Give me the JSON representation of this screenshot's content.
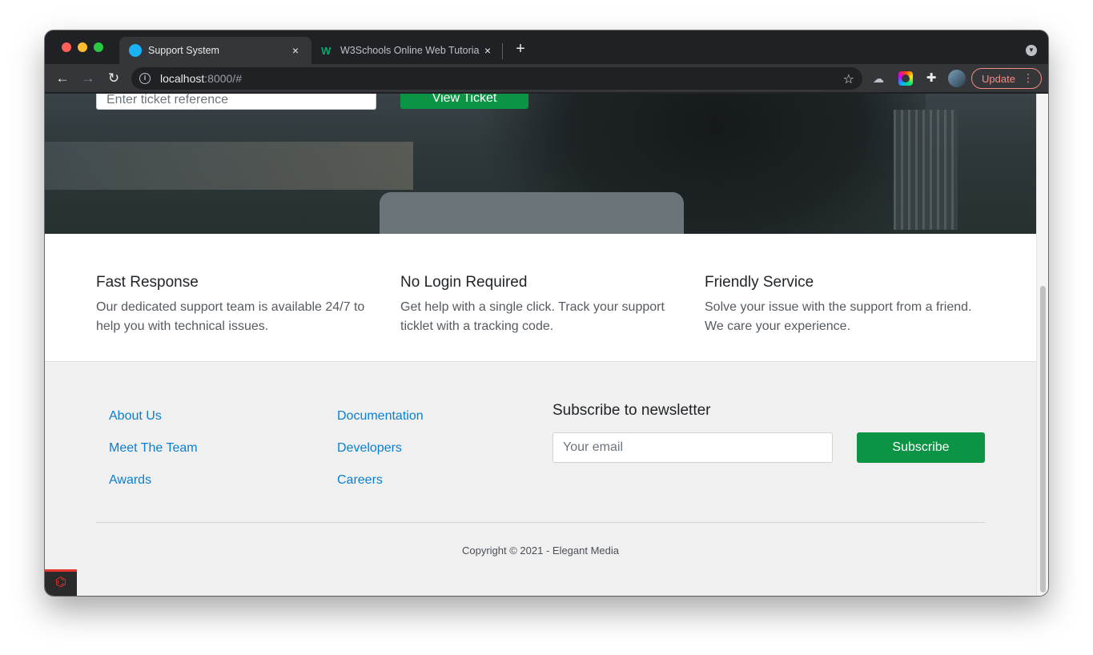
{
  "browser": {
    "tabs": [
      {
        "title": "Support System",
        "active": true
      },
      {
        "title": "W3Schools Online Web Tutoria",
        "active": false
      }
    ],
    "tab_close_glyph": "×",
    "new_tab_glyph": "+",
    "url_host": "localhost",
    "url_rest": ":8000/#",
    "update_label": "Update",
    "accent_colors": {
      "update": "#f28b82",
      "favicon": "#1ab2f5"
    }
  },
  "hero": {
    "ticket_placeholder": "Enter ticket reference",
    "view_ticket_label": "View Ticket"
  },
  "features": [
    {
      "title": "Fast Response",
      "text": "Our dedicated support team is available 24/7 to help you with technical issues."
    },
    {
      "title": "No Login Required",
      "text": "Get help with a single click. Track your support ticklet with a tracking code."
    },
    {
      "title": "Friendly Service",
      "text": "Solve your issue with the support from a friend. We care your experience."
    }
  ],
  "footer": {
    "links_col1": [
      "About Us",
      "Meet The Team",
      "Awards"
    ],
    "links_col2": [
      "Documentation",
      "Developers",
      "Careers"
    ],
    "newsletter_title": "Subscribe to newsletter",
    "email_placeholder": "Your email",
    "subscribe_label": "Subscribe",
    "copyright": "Copyright © 2021 - Elegant Media",
    "colors": {
      "link": "#0a7fd1",
      "button": "#0b9444",
      "background": "#f0f0f0"
    }
  },
  "icons": [
    "back-icon",
    "forward-icon",
    "reload-icon",
    "info-icon",
    "star-icon",
    "extension-icon",
    "puzzle-icon",
    "laravel-icon"
  ]
}
